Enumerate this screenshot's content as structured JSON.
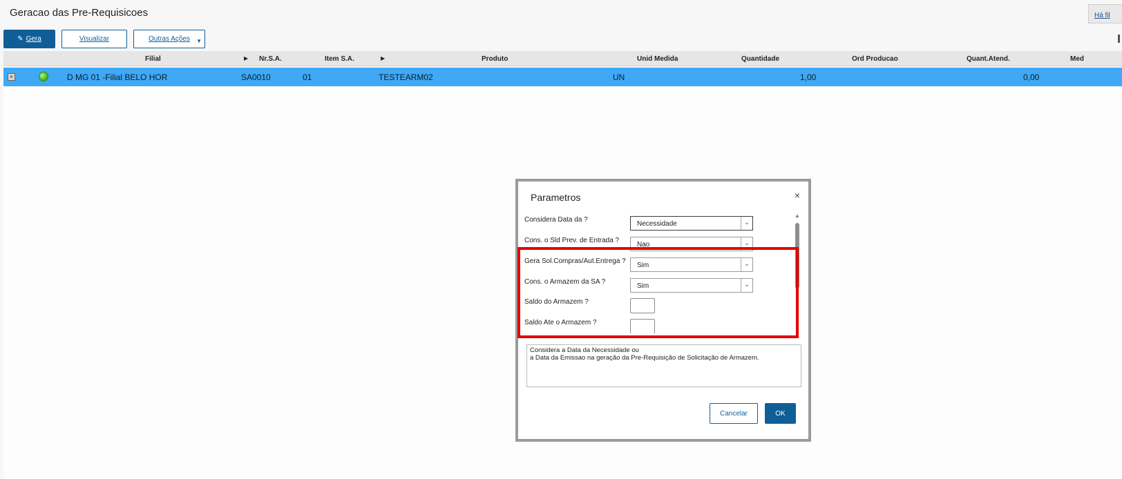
{
  "page": {
    "title": "Geracao das Pre-Requisicoes",
    "top_right_link": "Há fil"
  },
  "toolbar": {
    "gera_label": "Gera",
    "visualizar_label": "Visualizar",
    "outras_label": "Outras Ações"
  },
  "grid": {
    "columns": [
      "Filial",
      "Nr.S.A.",
      "Item S.A.",
      "Produto",
      "Unid Medida",
      "Quantidade",
      "Ord Producao",
      "Quant.Atend.",
      "Med"
    ],
    "rows": [
      {
        "filial": "D MG 01 -Filial BELO HOR",
        "nr_sa": "SA0010",
        "item_sa": "01",
        "produto": "TESTEARM02",
        "unid_medida": "UN",
        "quantidade": "1,00",
        "ord_producao": "",
        "quant_atend": "0,00",
        "status_color": "#3fae1f"
      }
    ]
  },
  "dialog": {
    "title": "Parametros",
    "close_symbol": "×",
    "params": [
      {
        "label": "Considera Data da ?",
        "type": "select",
        "value": "Necessidade"
      },
      {
        "label": "Cons. o Sld Prev. de Entrada ?",
        "type": "select",
        "value": "Nao"
      },
      {
        "label": "Gera Sol.Compras/Aut.Entrega ?",
        "type": "select",
        "value": "Sim"
      },
      {
        "label": "Cons. o Armazem da SA ?",
        "type": "select",
        "value": "Sim"
      },
      {
        "label": "Saldo do Armazem ?",
        "type": "input",
        "value": ""
      },
      {
        "label": "Saldo Ate o Armazem ?",
        "type": "input",
        "value": ""
      }
    ],
    "help_text_line1": "Considera a Data da Necessidade ou",
    "help_text_line2": "a Data da Emissao na geração da Pre-Requisição de Solicitação de Armazem.",
    "cancel_label": "Cancelar",
    "ok_label": "OK"
  },
  "colors": {
    "accent": "#0f5e98",
    "selected_row": "#3fa9f5",
    "highlight": "#e30000"
  }
}
